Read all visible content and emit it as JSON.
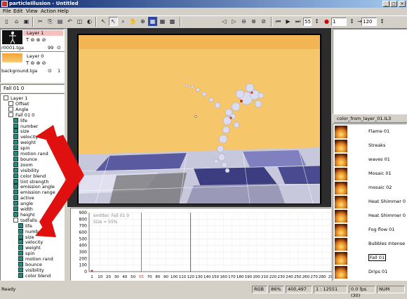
{
  "window": {
    "title": "particleIllusion - Untitled",
    "min": "_",
    "max": "□",
    "close": "×"
  },
  "menu": [
    "File",
    "Edit",
    "View",
    "Action",
    "Help"
  ],
  "toolbar": {
    "frame_value": "55",
    "second_value": "1",
    "fps_value": "120"
  },
  "layers": [
    {
      "name": "Layer 1",
      "file": "r0001.tga",
      "count": "99"
    },
    {
      "name": "Layer 0",
      "file": "background.tga",
      "count": "1"
    }
  ],
  "emitter_panel": {
    "header": "Fall 01 0"
  },
  "tree": [
    {
      "label": "Layer 1",
      "indent": 0,
      "top": true
    },
    {
      "label": "Offset",
      "indent": 1,
      "top": true
    },
    {
      "label": "Angle",
      "indent": 1,
      "top": true
    },
    {
      "label": "Fall 01 0",
      "indent": 1,
      "top": true
    },
    {
      "label": "life",
      "indent": 2
    },
    {
      "label": "number",
      "indent": 2
    },
    {
      "label": "size",
      "indent": 2
    },
    {
      "label": "velocity",
      "indent": 2
    },
    {
      "label": "weight",
      "indent": 2
    },
    {
      "label": "spin",
      "indent": 2
    },
    {
      "label": "motion rand",
      "indent": 2
    },
    {
      "label": "bounce",
      "indent": 2
    },
    {
      "label": "zoom",
      "indent": 2
    },
    {
      "label": "visibility",
      "indent": 2
    },
    {
      "label": "color blend",
      "indent": 2
    },
    {
      "label": "tint strength",
      "indent": 2
    },
    {
      "label": "emission angle",
      "indent": 2
    },
    {
      "label": "emission range",
      "indent": 2
    },
    {
      "label": "active",
      "indent": 2
    },
    {
      "label": "angle",
      "indent": 2
    },
    {
      "label": "width",
      "indent": 2
    },
    {
      "label": "height",
      "indent": 2
    },
    {
      "label": "todfalls",
      "indent": 2,
      "top": true
    },
    {
      "label": "life",
      "indent": 3
    },
    {
      "label": "number",
      "indent": 3
    },
    {
      "label": "size",
      "indent": 3
    },
    {
      "label": "velocity",
      "indent": 3
    },
    {
      "label": "weight",
      "indent": 3
    },
    {
      "label": "spin",
      "indent": 3
    },
    {
      "label": "motion rand",
      "indent": 3
    },
    {
      "label": "bounce",
      "indent": 3
    },
    {
      "label": "visibility",
      "indent": 3
    },
    {
      "label": "color blend",
      "indent": 3
    }
  ],
  "graph": {
    "info_line1": "emitter: Fall 01 0",
    "info_line2": "Size = 55%",
    "y_ticks": [
      "900",
      "800",
      "700",
      "600",
      "500",
      "400",
      "300",
      "200",
      "100",
      "0"
    ],
    "x_ticks": [
      "1",
      "10",
      "20",
      "30",
      "40",
      "50",
      "55",
      "70",
      "80",
      "90",
      "100",
      "110",
      "120",
      "130",
      "140",
      "150",
      "160",
      "170",
      "180",
      "190",
      "200",
      "210",
      "220",
      "230",
      "240",
      "250",
      "260",
      "270",
      "280",
      "29"
    ],
    "current_frame": 55
  },
  "library": {
    "header": "color_from_layer_01.IL3",
    "items": [
      "Flame 01",
      "Streaks",
      "waves 01",
      "Mosaic 01",
      "mosaic 02",
      "Heat Shimmer 0",
      "Heat Shimmer 0",
      "Fog flow 01",
      "Bubbles Intense",
      "Fall 01",
      "Drips 01"
    ]
  },
  "status": {
    "ready": "Ready",
    "mode": "RGB",
    "zoom": "86%",
    "coords": "400,497",
    "frame": "1 : 12551",
    "fps": "0.0 fps (30)",
    "num": "NUM"
  },
  "colors": {
    "title_start": "#0a246a",
    "title_end": "#a6caf0",
    "arrow": "#e01010",
    "cursor_line": "#e03030"
  }
}
